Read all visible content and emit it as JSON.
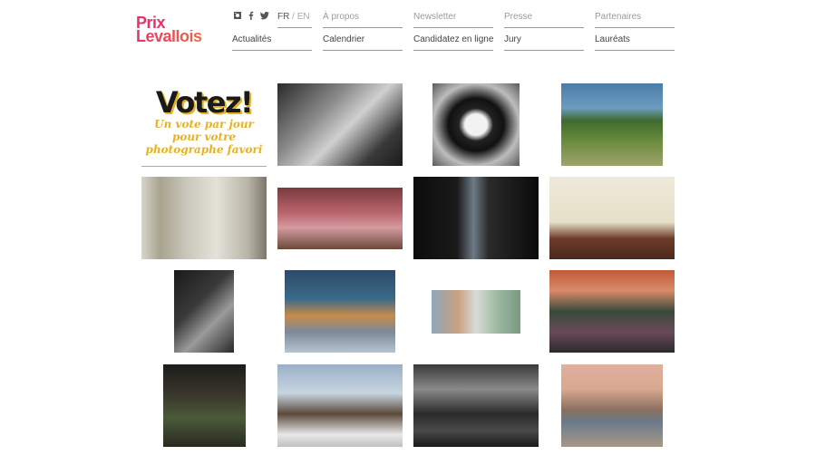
{
  "logo": {
    "line1": "Prix",
    "line2": "Levallois"
  },
  "social": [
    {
      "icon": "instagram-icon"
    },
    {
      "icon": "facebook-icon"
    },
    {
      "icon": "twitter-icon"
    }
  ],
  "lang": {
    "fr": "FR",
    "sep": "/",
    "en": "EN"
  },
  "nav_top": [
    "À propos",
    "Newsletter",
    "Presse",
    "Partenaires"
  ],
  "nav_bottom": [
    "Actualités",
    "Calendrier",
    "Candidatez en ligne",
    "Jury",
    "Lauréats"
  ],
  "vote": {
    "title": "Votez!",
    "line1": "Un vote par jour",
    "line2": "pour votre",
    "line3": "photographe favori"
  },
  "photos": [
    {
      "name": "photo-woman-doorway-bw",
      "bg": "linear-gradient(135deg,#2a2a2a 0%,#8a8a8a 35%,#d0d0d0 55%,#3a3a3a 80%,#1a1a1a 100%)"
    },
    {
      "name": "photo-bowl-figure-bw",
      "bg": "radial-gradient(ellipse at 50% 50%,#f2f2f2 0%,#f2f2f2 18%,#222 28%,#111 45%,#bdbdbd 70%,#5a5a5a 100%)"
    },
    {
      "name": "photo-palm-tent",
      "bg": "linear-gradient(180deg,#4a7ca8 0%,#6d9cc0 30%,#3f6a2e 45%,#6a8b3c 70%,#9fa36c 100%)"
    },
    {
      "name": "photo-room-doors",
      "bg": "linear-gradient(90deg,#d8d5cc 0%,#a8a38f 15%,#c8c5ba 35%,#e4e1d8 60%,#b8b5a8 85%,#7c766a 100%)"
    },
    {
      "name": "photo-pink-room",
      "bg": "linear-gradient(180deg,#7a3b40 0%,#b8646a 40%,#d59aa0 65%,#6b4a3a 100%)"
    },
    {
      "name": "photo-dark-window",
      "bg": "linear-gradient(90deg,#0c0c0c 0%,#1a1a1a 35%,#6e7a86 48%,#2a2a2a 60%,#0a0a0a 100%)"
    },
    {
      "name": "photo-couple-reading",
      "bg": "linear-gradient(180deg,#efe9da 0%,#e6dfc9 55%,#6f3b2a 75%,#4a2a1c 100%)"
    },
    {
      "name": "photo-veiled-figure-bw",
      "bg": "linear-gradient(135deg,#1a1a1a 0%,#3a3a3a 40%,#9a9a9a 65%,#2a2a2a 100%)"
    },
    {
      "name": "photo-arcade-street",
      "bg": "linear-gradient(180deg,#2d4a68 0%,#3b6a8a 35%,#c88a4a 55%,#7c8a9a 75%,#b8c4d0 100%)"
    },
    {
      "name": "photo-diptych-water",
      "bg": "linear-gradient(90deg,#8fa8b8 0%,#c9a080 30%,#d8dcd8 50%,#9ab8a0 75%,#7a9a80 100%)"
    },
    {
      "name": "photo-shrine-flowers",
      "bg": "linear-gradient(180deg,#c05a3a 0%,#d98a6a 25%,#3a4a3a 50%,#6a4a5a 75%,#2a2a2a 100%)"
    },
    {
      "name": "photo-forest-figure",
      "bg": "linear-gradient(180deg,#1c1c1a 0%,#3c3a2e 40%,#4a5a3a 65%,#2a2a20 100%)"
    },
    {
      "name": "photo-winter-walker",
      "bg": "linear-gradient(180deg,#9ab0c8 0%,#c8d4e0 35%,#5a4a3a 60%,#e8e8e8 85%,#c0c0c0 100%)"
    },
    {
      "name": "photo-cross-men-bw",
      "bg": "linear-gradient(180deg,#3a3a3a 0%,#8a8a8a 30%,#2a2a2a 60%,#4a4a4a 80%,#1a1a1a 100%)"
    },
    {
      "name": "photo-hill-town",
      "bg": "linear-gradient(180deg,#e0b0a0 0%,#d8a890 30%,#8a7060 55%,#6a7a8a 70%,#a89888 100%)"
    }
  ]
}
